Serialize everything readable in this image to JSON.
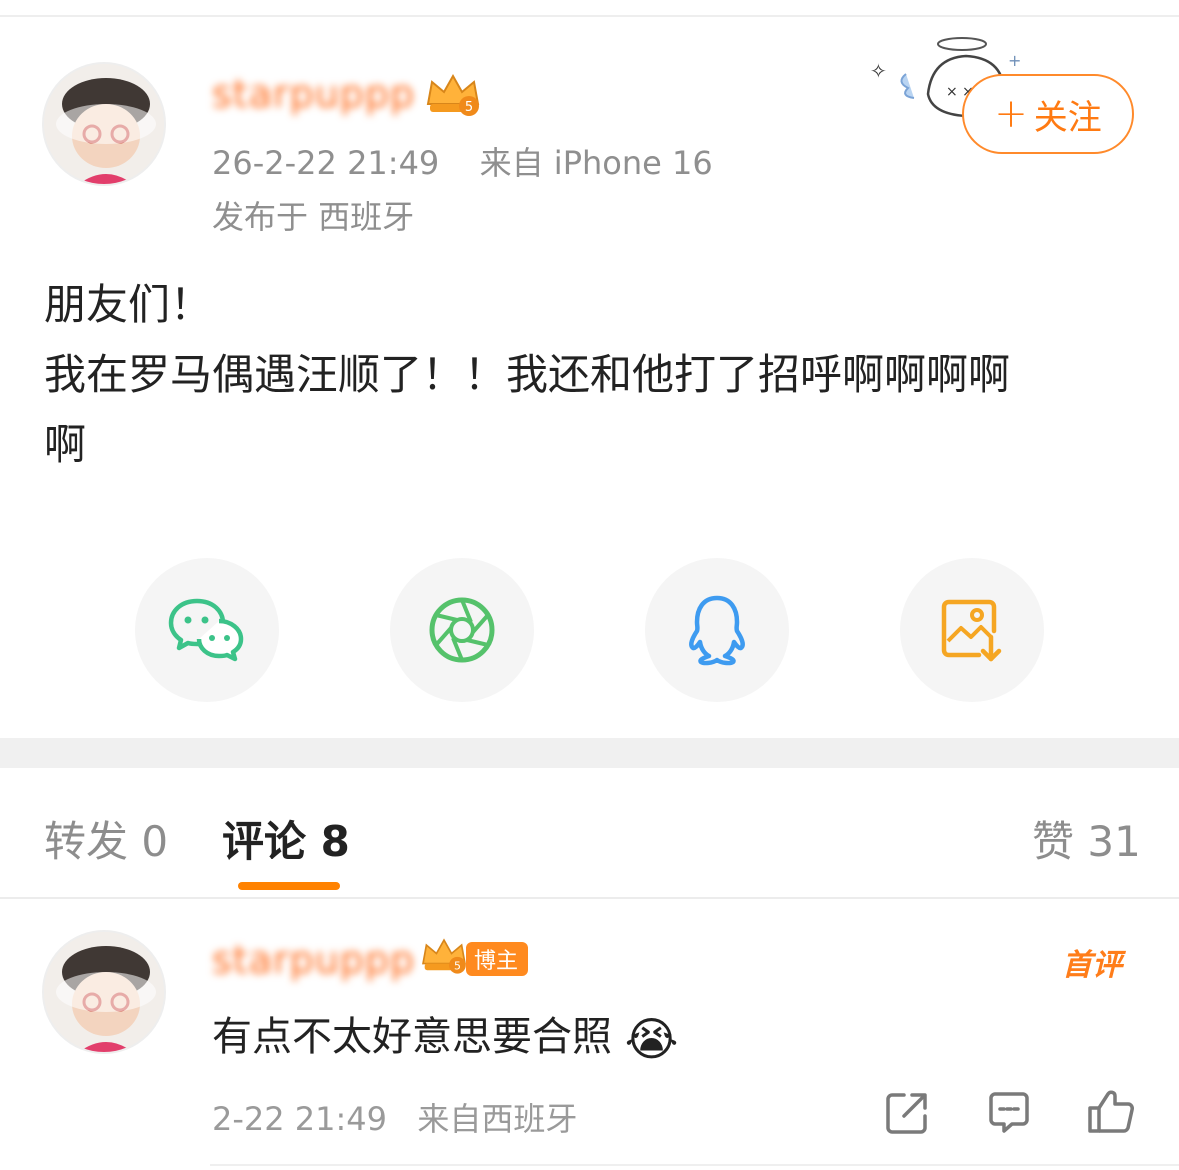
{
  "post": {
    "username": "starpuppp",
    "level_badge": "5",
    "timestamp": "26-2-22 21:49",
    "source": "来自 iPhone 16",
    "location": "发布于 西班牙",
    "follow_label": "关注",
    "text_line1": "朋友们！",
    "text_line2": "我在罗马偶遇汪顺了！！我还和他打了招呼啊啊啊啊",
    "text_line3": "啊"
  },
  "share": {
    "items": [
      {
        "icon": "wechat-icon",
        "color": "#3cc389"
      },
      {
        "icon": "moments-icon",
        "color": "#55c26b"
      },
      {
        "icon": "qq-icon",
        "color": "#3e9bf0"
      },
      {
        "icon": "save-image-icon",
        "color": "#f5a623"
      }
    ]
  },
  "tabs": {
    "repost": "转发 0",
    "comments": "评论 8",
    "likes": "赞 31"
  },
  "comment": {
    "username": "starpuppp",
    "level_badge": "5",
    "author_badge": "博主",
    "first_tag": "首评",
    "text": "有点不太好意思要合照",
    "emoji": "😭",
    "timestamp": "2-22 21:49",
    "source": "来自西班牙"
  },
  "colors": {
    "accent": "#ff8200",
    "follow": "#ff7a12",
    "meta_gray": "#8f8f8f"
  }
}
